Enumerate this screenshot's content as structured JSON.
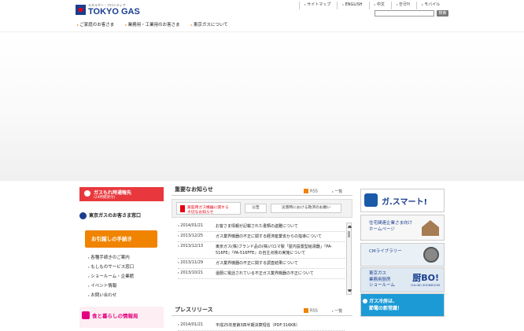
{
  "header": {
    "tagline": "エネルギー・フロンティア",
    "logo_text": "TOKYO GAS",
    "util_links": [
      "サイトマップ",
      "ENGLISH",
      "中文",
      "한국어",
      "モバイル"
    ],
    "search_placeholder": "",
    "search_button": "検索",
    "global_nav": [
      "ご家庭のお客さま",
      "業務用・工業用のお客さま",
      "東京ガスについて"
    ]
  },
  "left": {
    "leak_title": "ガスもれ時通報先",
    "leak_sub": "(24時間受付)",
    "customer_heading": "東京ガスのお客さま窓口",
    "procedure_button": "お引越しの手続き",
    "links": [
      "各種手続きのご案内",
      "もしものサービス窓口",
      "ショールーム・企業館",
      "イベント情報",
      "お問い合わせ"
    ],
    "life_heading": "食と暮らしの情報局"
  },
  "news": {
    "title": "重要なお知らせ",
    "rss": "RSS",
    "all": "一覧",
    "tab_important_1": "家庭用ガス機器に関する",
    "tab_important_2": "大切なお知らせ",
    "tab_notice": "公告",
    "tab_disaster": "災害時における救済のお願い",
    "items": [
      {
        "date": "2014/01/21",
        "text": "お客さま情報が記載された書類の盗難について"
      },
      {
        "date": "2013/12/25",
        "text": "ガス業界機器の不正に関する経済産業省からの指導について"
      },
      {
        "date": "2013/12/13",
        "text": "東京ガス(株)ブランド品の(株)パロマ製「屋内設置型給湯器」『PA-516FE』『PA-516FFE』の自主点検の実施について"
      },
      {
        "date": "2013/11/29",
        "text": "ガス業界機器の不正に関する調査結果について"
      },
      {
        "date": "2013/10/21",
        "text": "還暦に電話されている不正ガス業界機器の不正について"
      }
    ]
  },
  "press": {
    "title": "プレスリリース",
    "rss": "RSS",
    "all": "一覧",
    "items": [
      {
        "date": "2014/01/21",
        "text": "平成25年度第3四半期決算短信（PDF:316KB）"
      }
    ]
  },
  "banners": {
    "gas_smart": "ガ.スマート!",
    "housing_1": "住宅関連企業さま向け",
    "housing_2": "ホームページ",
    "cm": "CMライブラリー",
    "biz_1": "東京ガス",
    "biz_2": "業務用厨房",
    "biz_3": "ショールーム",
    "biz_logo": "厨BO!",
    "biz_sub": "CHU-BO SHOWROOM",
    "save_1": "ガス冷房は、",
    "save_2": "節電の新常識！"
  }
}
